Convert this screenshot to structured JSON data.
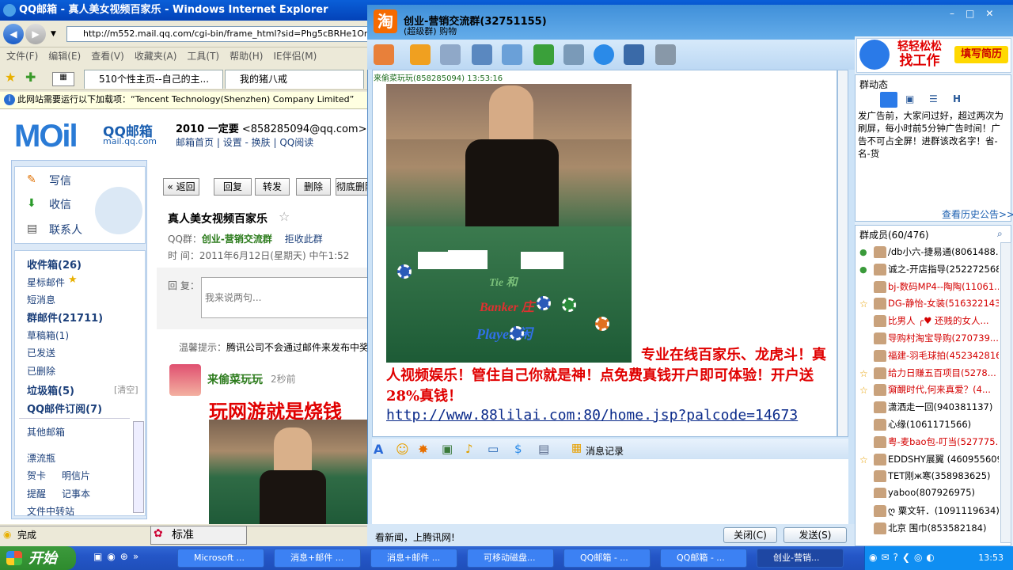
{
  "ie": {
    "title": "QQ邮箱 - 真人美女视频百家乐 - Windows Internet Explorer",
    "address": "http://m552.mail.qq.com/cgi-bin/frame_html?sid=Phg5cBRHe1On1",
    "menu": [
      "文件(F)",
      "编辑(E)",
      "查看(V)",
      "收藏夹(A)",
      "工具(T)",
      "帮助(H)",
      "IE伴侣(M)"
    ],
    "tabs": [
      "510个性主页--自己的主...",
      "我的猪八戒"
    ],
    "infobar": "此网站需要运行以下加载项：“Tencent Technology(Shenzhen) Company Limited”",
    "status": "完成",
    "ime": "标准"
  },
  "mail": {
    "logo": "MOil",
    "logo_cn": "QQ邮箱",
    "logo_url": "mail.qq.com",
    "user": "2010 一定要",
    "email": "<858285094@qq.com>",
    "links": [
      "邮箱首页",
      "设置 - 换肤",
      "QQ阅读"
    ],
    "nav": [
      "写信",
      "收信",
      "联系人"
    ],
    "folders": [
      "收件箱(26)",
      "星标邮件",
      "短消息",
      "群邮件(21711)",
      "草稿箱(1)",
      "已发送",
      "已删除",
      "垃圾箱(5)",
      "QQ邮件订阅(7)"
    ],
    "clear": "[清空]",
    "others": [
      "其他邮箱",
      "漂流瓶",
      "贺卡",
      "明信片",
      "提醒",
      "记事本",
      "文件中转站"
    ],
    "toolbar": [
      "« 返回",
      "回复",
      "转发",
      "删除",
      "彻底删除"
    ],
    "subject": "真人美女视频百家乐",
    "group_label": "QQ群：",
    "group_name": "创业-营销交流群",
    "reject": "拒收此群",
    "time_label": "时 间：",
    "time": "2011年6月12日(星期天) 中午1:52",
    "reply_label": "回 复：",
    "reply_placeholder": "我来说两句...",
    "tip_label": "温馨提示：",
    "tip": "腾讯公司不会通过邮件来发布中奖",
    "sender": "来偷菜玩玩",
    "ago": "2秒前",
    "headline": "玩网游就是烧钱"
  },
  "qq": {
    "group_title": "创业-营销交流群(32751155)",
    "group_sub": "(超级群) 购物",
    "msg_sender": "来偷菜玩玩(858285094)  13:53:16",
    "msg_text": "专业在线百家乐、龙虎斗！真人视频娱乐！管住自己你就是神！点免费真钱开户即可体验！开户送28%真钱！",
    "msg_link": "http://www.88lilai.com:80/home.jsp?palcode=14673",
    "photo_words": [
      "Tie 和",
      "Banker 庄",
      "Player 闲"
    ],
    "msg_history": "消息记录",
    "news": "看新闻，上腾讯网!",
    "close": "关闭(C)",
    "send": "发送(S)",
    "ad_line1": "轻轻松松",
    "ad_line2": "找工作",
    "ad_btn": "填写简历",
    "dyn_title": "群动态",
    "notice": "发广告前，大家问过好，超过两次为刷屏，每小时前5分钟广告时间！广告不可占全屏！进群该改名字！省-名-货",
    "history": "查看历史公告>>",
    "members_title": "群成员(60/476)",
    "members": [
      {
        "name": "/db小六-捷易通(8061488...",
        "color": "#000"
      },
      {
        "name": "诚之-开店指导(252272568)",
        "color": "#000"
      },
      {
        "name": "bj-数码MP4--陶陶(11061...",
        "color": "#d40000"
      },
      {
        "name": "DG-静怡-女装(516322143)",
        "color": "#d40000"
      },
      {
        "name": "比男人 ╭♥ 还贱的女人...",
        "color": "#d40000"
      },
      {
        "name": "导购村淘宝导购(270739...",
        "color": "#d40000"
      },
      {
        "name": "福建-羽毛球拍(452342816)",
        "color": "#d40000"
      },
      {
        "name": "给力日赚五百项目(5278...",
        "color": "#d40000"
      },
      {
        "name": "奫靦时代,何来真爱？(4...",
        "color": "#d40000"
      },
      {
        "name": "潇洒走一回(940381137)",
        "color": "#000"
      },
      {
        "name": "心缘(1061171566)",
        "color": "#000"
      },
      {
        "name": "粤-麦bao包-叮当(527775...",
        "color": "#d40000"
      },
      {
        "name": "EDDSHY展翼 (460955609)",
        "color": "#000"
      },
      {
        "name": "TET刚ж寒(358983625)",
        "color": "#000"
      },
      {
        "name": "yaboo(807926975)",
        "color": "#000"
      },
      {
        "name": "ღ 粟文轩．(1091119634)",
        "color": "#000"
      },
      {
        "name": "北京 围巾(853582184)",
        "color": "#000"
      }
    ]
  },
  "taskbar": {
    "start": "开始",
    "items": [
      "Microsoft ...",
      "消息+邮件 ...",
      "消息+邮件 ...",
      "可移动磁盘...",
      "QQ邮箱 - ...",
      "QQ邮箱 - ...",
      "创业-营销..."
    ],
    "clock": "13:53"
  }
}
